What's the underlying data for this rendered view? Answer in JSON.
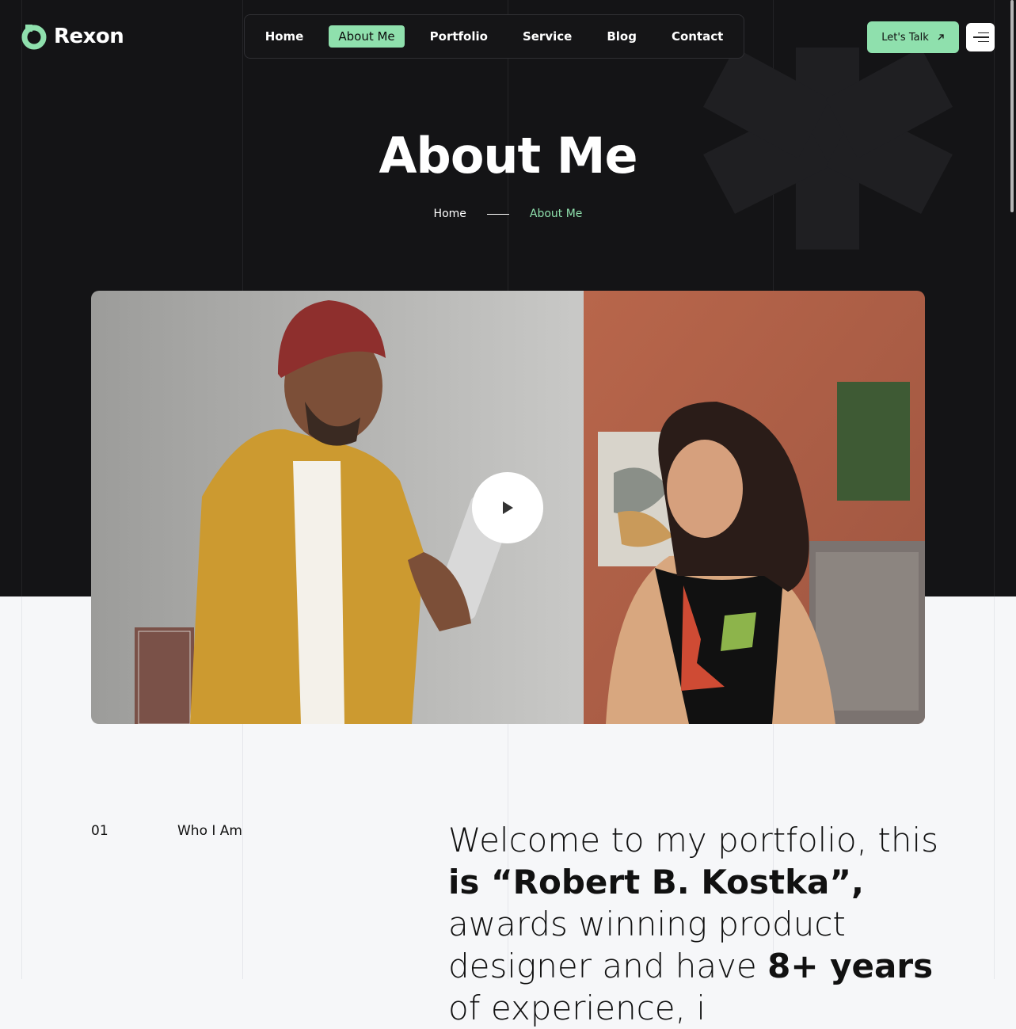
{
  "brand": {
    "name": "Rexon"
  },
  "nav": {
    "items": [
      {
        "label": "Home",
        "active": false
      },
      {
        "label": "About Me",
        "active": true
      },
      {
        "label": "Portfolio",
        "active": false
      },
      {
        "label": "Service",
        "active": false
      },
      {
        "label": "Blog",
        "active": false
      },
      {
        "label": "Contact",
        "active": false
      }
    ]
  },
  "header": {
    "cta_label": "Let's Talk",
    "cta_icon": "arrow-up-right-icon",
    "menu_icon": "hamburger-icon"
  },
  "page": {
    "title": "About Me",
    "breadcrumb": {
      "home": "Home",
      "current": "About Me"
    }
  },
  "media": {
    "play_icon": "play-icon"
  },
  "section": {
    "number": "01",
    "label": "Who I Am",
    "intro_1": "Welcome to my portfolio, this ",
    "intro_2": "is “Robert B. Kostka”,",
    "intro_3": " awards winning product designer and have ",
    "intro_4": "8+ years",
    "intro_5": " of experience, i"
  },
  "colors": {
    "accent": "#8fe0ad",
    "dark": "#141416",
    "light": "#f6f7f9"
  }
}
